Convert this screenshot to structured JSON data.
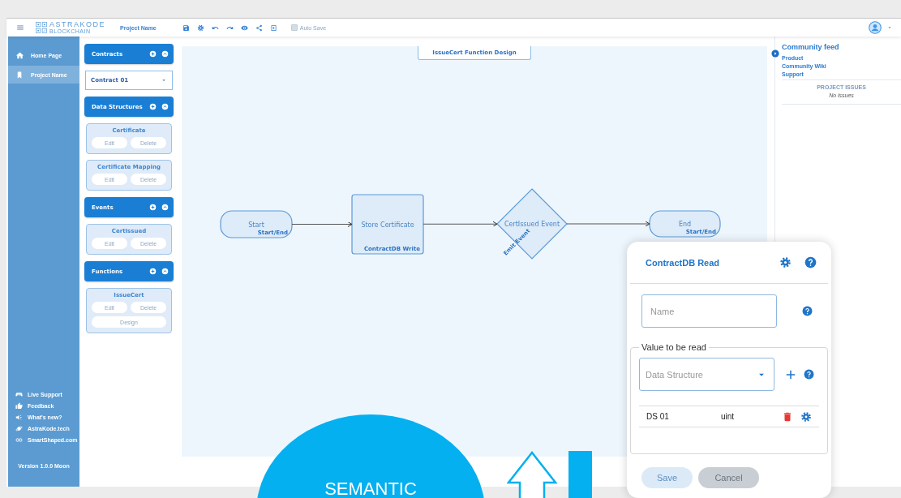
{
  "top_bar": {
    "logo": {
      "name": "ASTRAKODE",
      "tagline": "BLOCKCHAIN"
    },
    "project_name": "Project Name",
    "auto_save": {
      "label": "Auto Save",
      "checked": false
    }
  },
  "sidebar": {
    "nav": [
      {
        "label": "Home Page",
        "selected": false
      },
      {
        "label": "Project Name",
        "selected": true
      }
    ],
    "links": [
      "Live Support",
      "Feedback",
      "What's new?",
      "AstraKode.tech",
      "SmartShaped.com"
    ],
    "version": "Version 1.0.0 Moon"
  },
  "panel": {
    "sections": [
      {
        "title": "Contracts",
        "kind": "dropdown",
        "value": "Contract 01"
      },
      {
        "title": "Data Structures",
        "kind": "cards",
        "items": [
          {
            "name": "Certificate",
            "buttons": [
              "Edit",
              "Delete"
            ]
          },
          {
            "name": "Certificate Mapping",
            "buttons": [
              "Edit",
              "Delete"
            ]
          }
        ]
      },
      {
        "title": "Events",
        "kind": "cards",
        "items": [
          {
            "name": "CertIssued",
            "buttons": [
              "Edit",
              "Delete"
            ]
          }
        ]
      },
      {
        "title": "Functions",
        "kind": "cards",
        "items": [
          {
            "name": "IssueCert",
            "buttons": [
              "Edit",
              "Delete",
              "Design"
            ]
          }
        ]
      }
    ]
  },
  "diagram": {
    "title": "IssueCert Function Design",
    "nodes": [
      {
        "kind": "terminal",
        "label": "Start",
        "type_label": "Start/End"
      },
      {
        "kind": "process",
        "label": "Store Certificate",
        "type_label": "ContractDB Write"
      },
      {
        "kind": "decision",
        "label": "CertIssued Event",
        "type_label": "Emit Event"
      },
      {
        "kind": "terminal",
        "label": "End",
        "type_label": "Start/End"
      }
    ]
  },
  "community": {
    "title": "Community feed",
    "links": [
      "Product",
      "Community Wiki",
      "Support"
    ],
    "issues_heading": "PROJECT ISSUES",
    "issues_text": "No issues"
  },
  "dialog": {
    "title": "ContractDB Read",
    "name_field": {
      "placeholder": "Name"
    },
    "group_label": "Value to be read",
    "select": {
      "placeholder": "Data Structure"
    },
    "rows": [
      {
        "name": "DS 01",
        "type": "uint"
      }
    ],
    "buttons": [
      "Save",
      "Cancel"
    ]
  },
  "overlay": {
    "badge_text": "SEMANTIC"
  }
}
